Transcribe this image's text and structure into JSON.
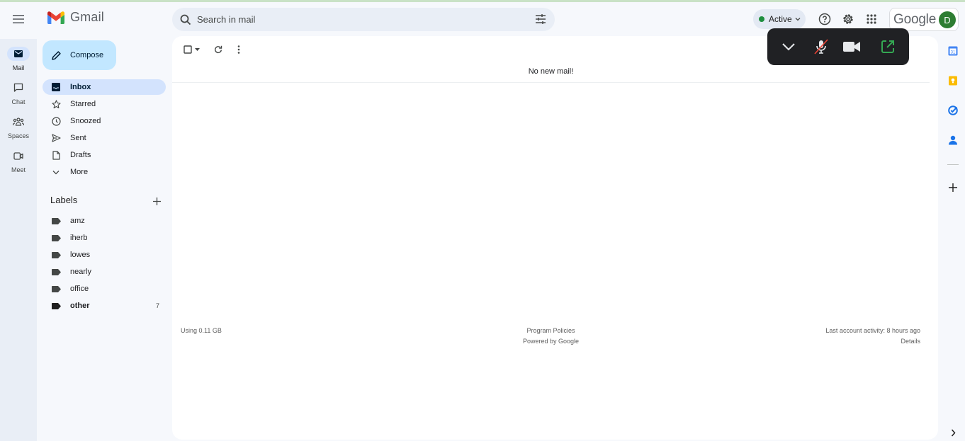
{
  "app": {
    "name": "Gmail"
  },
  "header": {
    "search_placeholder": "Search in mail",
    "status_label": "Active",
    "status_color": "#1e8e3e",
    "google_text": "Google",
    "avatar_letter": "D",
    "icons": [
      "hamburger-menu-icon",
      "search-icon",
      "tune-icon",
      "help-icon",
      "settings-icon",
      "apps-grid-icon"
    ]
  },
  "rail": {
    "items": [
      {
        "label": "Mail",
        "icon": "mail-icon",
        "active": true
      },
      {
        "label": "Chat",
        "icon": "chat-icon"
      },
      {
        "label": "Spaces",
        "icon": "spaces-icon"
      },
      {
        "label": "Meet",
        "icon": "meet-icon"
      }
    ]
  },
  "nav": {
    "compose_label": "Compose",
    "folders": [
      {
        "label": "Inbox",
        "icon": "inbox-icon",
        "active": true
      },
      {
        "label": "Starred",
        "icon": "star-icon"
      },
      {
        "label": "Snoozed",
        "icon": "clock-icon"
      },
      {
        "label": "Sent",
        "icon": "send-icon"
      },
      {
        "label": "Drafts",
        "icon": "draft-icon"
      },
      {
        "label": "More",
        "icon": "chevron-down-icon"
      }
    ],
    "labels_title": "Labels",
    "labels": [
      {
        "label": "amz"
      },
      {
        "label": "iherb"
      },
      {
        "label": "lowes"
      },
      {
        "label": "nearly"
      },
      {
        "label": "office"
      },
      {
        "label": "other",
        "count": "7",
        "bold": true
      }
    ]
  },
  "main": {
    "empty_message": "No new mail!",
    "footer": {
      "storage": "Using 0.11 GB",
      "program_policies": "Program Policies",
      "powered_by": "Powered by Google",
      "last_activity": "Last account activity: 8 hours ago",
      "details": "Details"
    }
  },
  "call_panel": {
    "icons": [
      "chevron-down-icon",
      "mic-off-icon",
      "video-camera-icon",
      "open-external-icon"
    ],
    "mic_off_color": "#ea4335",
    "open_color": "#34a853"
  },
  "right_rail": {
    "icons": [
      "calendar-icon",
      "keep-icon",
      "tasks-icon",
      "contacts-icon",
      "add-icon",
      "expand-icon"
    ]
  }
}
